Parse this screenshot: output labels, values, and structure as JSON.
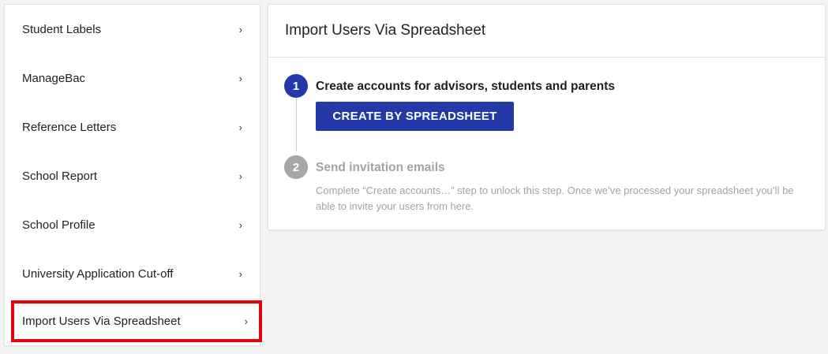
{
  "sidebar": {
    "items": [
      {
        "label": "Student Labels",
        "chevron": "›"
      },
      {
        "label": "ManageBac",
        "chevron": "›"
      },
      {
        "label": "Reference Letters",
        "chevron": "›"
      },
      {
        "label": "School Report",
        "chevron": "›"
      },
      {
        "label": "School Profile",
        "chevron": "›"
      },
      {
        "label": "University Application Cut-off",
        "chevron": "›"
      },
      {
        "label": "Import Users Via Spreadsheet",
        "chevron": "›",
        "selected": true
      }
    ],
    "highlight_color": "#e3050b"
  },
  "main": {
    "title": "Import Users Via Spreadsheet",
    "steps": [
      {
        "number": "1",
        "title": "Create accounts for advisors, students and parents",
        "button_label": "CREATE BY SPREADSHEET",
        "state": "active"
      },
      {
        "number": "2",
        "title": "Send invitation emails",
        "description": "Complete “Create accounts…” step to unlock this step. Once we’ve processed your spreadsheet you’ll be able to invite your users from here.",
        "state": "locked"
      }
    ],
    "accent_color": "#2538a8",
    "disabled_color": "#a6a6a6"
  }
}
